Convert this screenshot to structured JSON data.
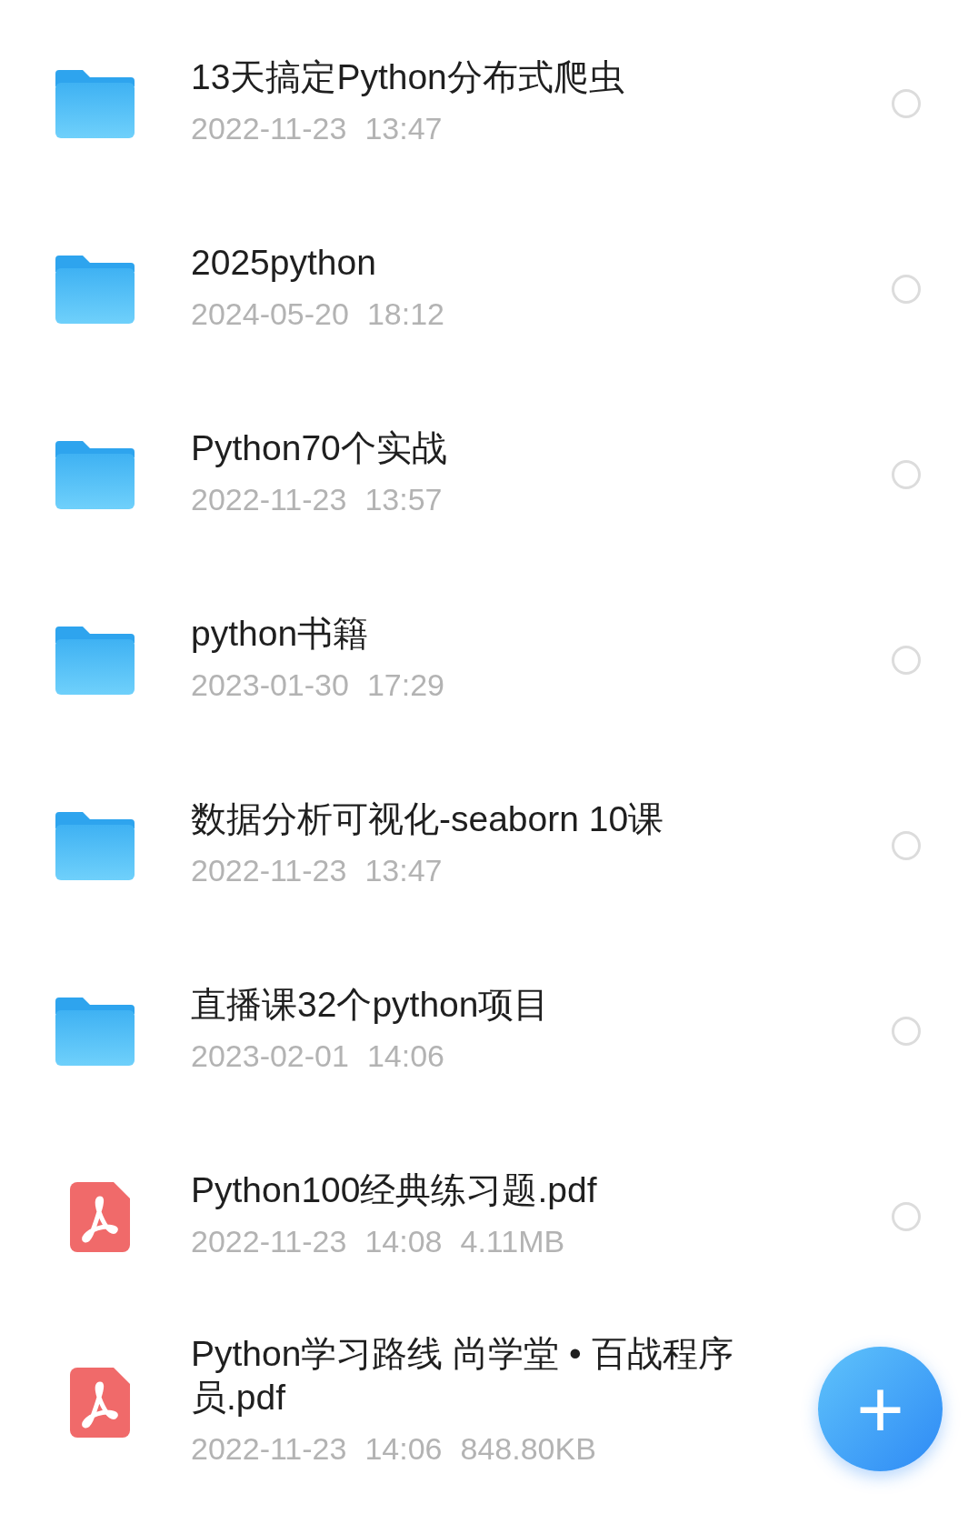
{
  "files": [
    {
      "kind": "folder",
      "name": "13天搞定Python分布式爬虫",
      "date": "2022-11-23",
      "time": "13:47",
      "selected": false
    },
    {
      "kind": "folder",
      "name": "2025python",
      "date": "2024-05-20",
      "time": "18:12",
      "selected": false
    },
    {
      "kind": "folder",
      "name": "Python70个实战",
      "date": "2022-11-23",
      "time": "13:57",
      "selected": false
    },
    {
      "kind": "folder",
      "name": "python书籍",
      "date": "2023-01-30",
      "time": "17:29",
      "selected": false
    },
    {
      "kind": "folder",
      "name": "数据分析可视化-seaborn 10课",
      "date": "2022-11-23",
      "time": "13:47",
      "selected": false
    },
    {
      "kind": "folder",
      "name": "直播课32个python项目",
      "date": "2023-02-01",
      "time": "14:06",
      "selected": false
    },
    {
      "kind": "pdf",
      "name": "Python100经典练习题.pdf",
      "date": "2022-11-23",
      "time": "14:08",
      "size": "4.11MB",
      "selected": false
    },
    {
      "kind": "pdf",
      "name": "Python学习路线 尚学堂 • 百战程序员.pdf",
      "date": "2022-11-23",
      "time": "14:06",
      "size": "848.80KB"
    }
  ],
  "fab": {
    "label": "+"
  }
}
